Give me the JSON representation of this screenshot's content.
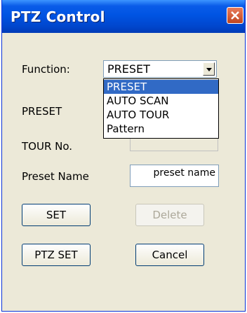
{
  "window": {
    "title": "PTZ Control"
  },
  "labels": {
    "function": "Function:",
    "preset": "PRESET",
    "tour_no": "TOUR No.",
    "preset_name": "Preset Name"
  },
  "function_select": {
    "value": "PRESET",
    "options": [
      "PRESET",
      "AUTO SCAN",
      "AUTO TOUR",
      "Pattern"
    ],
    "highlighted": "PRESET"
  },
  "preset_name_field": {
    "value": "preset name"
  },
  "buttons": {
    "set": "SET",
    "delete": "Delete",
    "ptz_set": "PTZ SET",
    "cancel": "Cancel"
  },
  "icons": {
    "close": "close-icon",
    "dropdown": "chevron-down-icon"
  }
}
